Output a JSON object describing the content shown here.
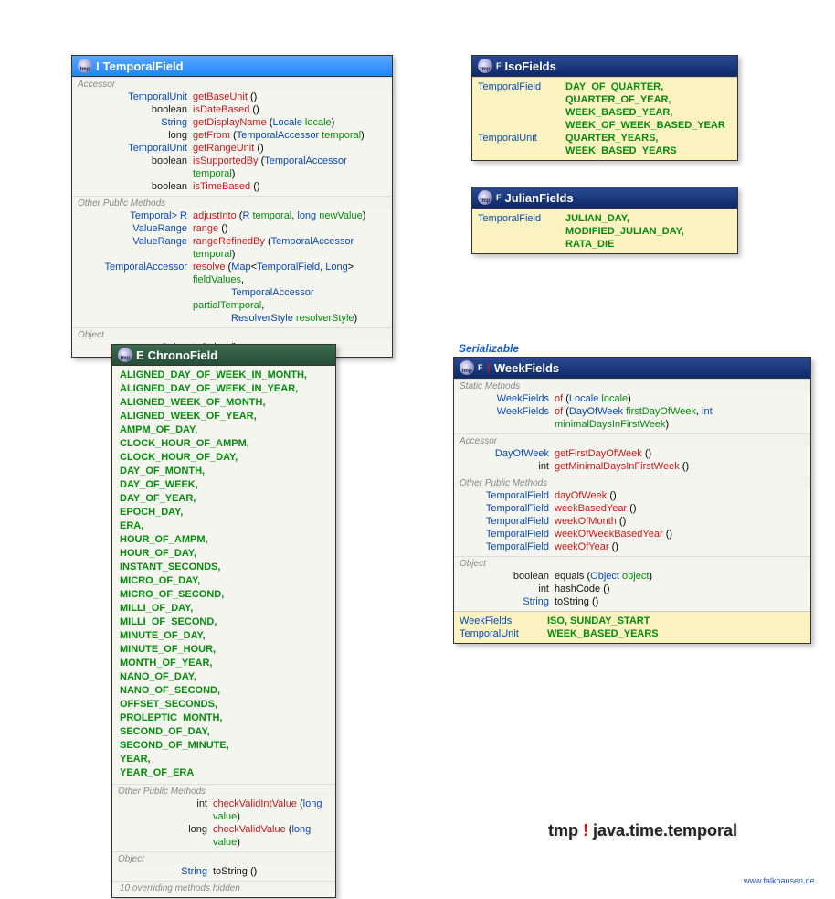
{
  "package": {
    "label": "java.time.temporal"
  },
  "credit": "www.falkhausen.de",
  "serializable_label": "Serializable",
  "temporalField": {
    "title": "TemporalField",
    "icon": "tmp",
    "marker": "I",
    "sections": {
      "accessor_label": "Accessor",
      "other_label": "Other Public Methods",
      "object_label": "Object"
    },
    "accessor": [
      {
        "ret": "TemporalUnit",
        "name": "getBaseUnit",
        "params": ""
      },
      {
        "ret": "boolean",
        "name": "isDateBased",
        "params": ""
      },
      {
        "ret": "String",
        "name": "getDisplayName",
        "params": "(Locale locale)",
        "ptypes": [
          "Locale"
        ],
        "pnames": [
          "locale"
        ]
      },
      {
        "ret": "long",
        "name": "getFrom",
        "params": "(TemporalAccessor temporal)",
        "ptypes": [
          "TemporalAccessor"
        ],
        "pnames": [
          "temporal"
        ]
      },
      {
        "ret": "TemporalUnit",
        "name": "getRangeUnit",
        "params": ""
      },
      {
        "ret": "boolean",
        "name": "isSupportedBy",
        "params": "(TemporalAccessor temporal)",
        "ptypes": [
          "TemporalAccessor"
        ],
        "pnames": [
          "temporal"
        ]
      },
      {
        "ret": "boolean",
        "name": "isTimeBased",
        "params": ""
      }
    ],
    "other_pfx": "<R extends Temporal> R",
    "other": [
      {
        "ret": "<R extends Temporal> R",
        "name": "adjustInto",
        "params": "(R temporal, long newValue)"
      },
      {
        "ret": "ValueRange",
        "name": "range",
        "params": ""
      },
      {
        "ret": "ValueRange",
        "name": "rangeRefinedBy",
        "params": "(TemporalAccessor temporal)"
      },
      {
        "ret": "TemporalAccessor",
        "name": "resolve",
        "params": "(Map<TemporalField, Long> fieldValues,"
      },
      {
        "ret": "",
        "name": "",
        "params": "TemporalAccessor partialTemporal,"
      },
      {
        "ret": "",
        "name": "",
        "params": "ResolverStyle resolverStyle)"
      }
    ],
    "object": [
      {
        "ret": "String",
        "name": "toString",
        "params": ""
      }
    ]
  },
  "isoFields": {
    "title": "IsoFields",
    "marker": "F",
    "lines": [
      {
        "ret": "TemporalField",
        "vals": "DAY_OF_QUARTER,"
      },
      {
        "ret": "",
        "vals": "QUARTER_OF_YEAR,"
      },
      {
        "ret": "",
        "vals": "WEEK_BASED_YEAR,"
      },
      {
        "ret": "",
        "vals": "WEEK_OF_WEEK_BASED_YEAR"
      },
      {
        "ret": "TemporalUnit",
        "vals": "QUARTER_YEARS,"
      },
      {
        "ret": "",
        "vals": "WEEK_BASED_YEARS"
      }
    ]
  },
  "julianFields": {
    "title": "JulianFields",
    "marker": "F",
    "lines": [
      {
        "ret": "TemporalField",
        "vals": "JULIAN_DAY,"
      },
      {
        "ret": "",
        "vals": "MODIFIED_JULIAN_DAY,"
      },
      {
        "ret": "",
        "vals": "RATA_DIE"
      }
    ]
  },
  "chronoField": {
    "title": "ChronoField",
    "marker": "E",
    "sections": {
      "other_label": "Other Public Methods",
      "object_label": "Object"
    },
    "constants": [
      "ALIGNED_DAY_OF_WEEK_IN_MONTH,",
      "ALIGNED_DAY_OF_WEEK_IN_YEAR,",
      "ALIGNED_WEEK_OF_MONTH,",
      "ALIGNED_WEEK_OF_YEAR,",
      "AMPM_OF_DAY,",
      "CLOCK_HOUR_OF_AMPM,",
      "CLOCK_HOUR_OF_DAY,",
      "DAY_OF_MONTH,",
      "DAY_OF_WEEK,",
      "DAY_OF_YEAR,",
      "EPOCH_DAY,",
      "ERA,",
      "HOUR_OF_AMPM,",
      "HOUR_OF_DAY,",
      "INSTANT_SECONDS,",
      "MICRO_OF_DAY,",
      "MICRO_OF_SECOND,",
      "MILLI_OF_DAY,",
      "MILLI_OF_SECOND,",
      "MINUTE_OF_DAY,",
      "MINUTE_OF_HOUR,",
      "MONTH_OF_YEAR,",
      "NANO_OF_DAY,",
      "NANO_OF_SECOND,",
      "OFFSET_SECONDS,",
      "PROLEPTIC_MONTH,",
      "SECOND_OF_DAY,",
      "SECOND_OF_MINUTE,",
      "YEAR,",
      "YEAR_OF_ERA"
    ],
    "other": [
      {
        "ret": "int",
        "name": "checkValidIntValue",
        "params": "(long value)"
      },
      {
        "ret": "long",
        "name": "checkValidValue",
        "params": "(long value)"
      }
    ],
    "object": [
      {
        "ret": "String",
        "name": "toString",
        "params": ""
      }
    ],
    "hidden_note": "10 overriding methods hidden"
  },
  "weekFields": {
    "title": "WeekFields",
    "marker": "F",
    "sections": {
      "static_label": "Static Methods",
      "accessor_label": "Accessor",
      "other_label": "Other Public Methods",
      "object_label": "Object"
    },
    "static": [
      {
        "ret": "WeekFields",
        "name": "of",
        "params": "(Locale locale)"
      },
      {
        "ret": "WeekFields",
        "name": "of",
        "params": "(DayOfWeek firstDayOfWeek, int minimalDaysInFirstWeek)"
      }
    ],
    "accessor": [
      {
        "ret": "DayOfWeek",
        "name": "getFirstDayOfWeek",
        "params": ""
      },
      {
        "ret": "int",
        "name": "getMinimalDaysInFirstWeek",
        "params": ""
      }
    ],
    "other": [
      {
        "ret": "TemporalField",
        "name": "dayOfWeek",
        "params": ""
      },
      {
        "ret": "TemporalField",
        "name": "weekBasedYear",
        "params": ""
      },
      {
        "ret": "TemporalField",
        "name": "weekOfMonth",
        "params": ""
      },
      {
        "ret": "TemporalField",
        "name": "weekOfWeekBasedYear",
        "params": ""
      },
      {
        "ret": "TemporalField",
        "name": "weekOfYear",
        "params": ""
      }
    ],
    "object": [
      {
        "ret": "boolean",
        "name": "equals",
        "params": "(Object object)"
      },
      {
        "ret": "int",
        "name": "hashCode",
        "params": ""
      },
      {
        "ret": "String",
        "name": "toString",
        "params": ""
      }
    ],
    "consts": [
      {
        "ret": "WeekFields",
        "vals": "ISO, SUNDAY_START"
      },
      {
        "ret": "TemporalUnit",
        "vals": "WEEK_BASED_YEARS"
      }
    ]
  }
}
